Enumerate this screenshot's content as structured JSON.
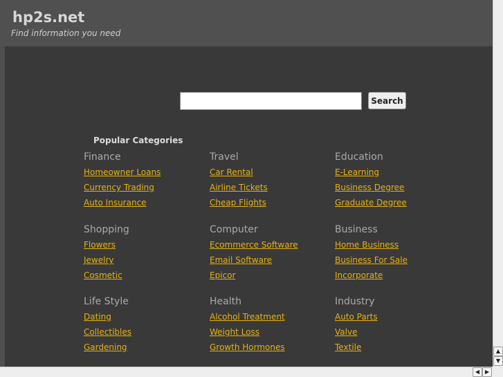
{
  "header": {
    "logo": "hp2s.net",
    "tagline": "Find information you need"
  },
  "search": {
    "placeholder": "",
    "button": "Search"
  },
  "popular_title": "Popular Categories",
  "categories": [
    {
      "title": "Finance",
      "links": [
        "Homeowner Loans",
        "Currency Trading",
        "Auto Insurance"
      ]
    },
    {
      "title": "Travel",
      "links": [
        "Car Rental",
        "Airline Tickets",
        "Cheap Flights"
      ]
    },
    {
      "title": "Education",
      "links": [
        "E-Learning",
        "Business Degree",
        "Graduate Degree"
      ]
    },
    {
      "title": "Shopping",
      "links": [
        "Flowers",
        "Jewelry",
        "Cosmetic"
      ]
    },
    {
      "title": "Computer",
      "links": [
        "Ecommerce Software",
        "Email Software",
        "Epicor"
      ]
    },
    {
      "title": "Business",
      "links": [
        "Home Business",
        "Business For Sale",
        "Incorporate"
      ]
    },
    {
      "title": "Life Style",
      "links": [
        "Dating",
        "Collectibles",
        "Gardening"
      ]
    },
    {
      "title": "Health",
      "links": [
        "Alcohol Treatment",
        "Weight Loss",
        "Growth Hormones"
      ]
    },
    {
      "title": "Industry",
      "links": [
        "Auto Parts",
        "Valve",
        "Textile"
      ]
    }
  ],
  "icons": {
    "up": "▲",
    "down": "▼",
    "left": "◀",
    "right": "▶"
  }
}
